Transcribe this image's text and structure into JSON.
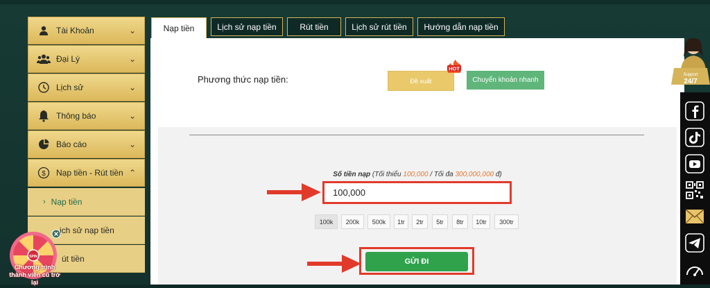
{
  "sidebar": {
    "items": [
      {
        "label": "Tài Khoản",
        "icon": "user-icon"
      },
      {
        "label": "Đại Lý",
        "icon": "group-icon"
      },
      {
        "label": "Lịch sử",
        "icon": "history-icon"
      },
      {
        "label": "Thông báo",
        "icon": "bell-icon"
      },
      {
        "label": "Báo cáo",
        "icon": "pie-chart-icon"
      },
      {
        "label": "Nạp tiền - Rút tiền",
        "icon": "money-circle-icon"
      }
    ],
    "sub_items": [
      {
        "label": "Nạp tiền"
      },
      {
        "label": "ịch sử nạp tiền"
      },
      {
        "label": "út tiền"
      }
    ]
  },
  "tabs": [
    {
      "label": "Nạp tiền"
    },
    {
      "label": "Lịch sử nạp tiền"
    },
    {
      "label": "Rút tiền"
    },
    {
      "label": "Lịch sử rút tiền"
    },
    {
      "label": "Hướng dẫn nạp tiền"
    }
  ],
  "method": {
    "label": "Phương thức nạp tiền:",
    "suggest_label": "Đề xuất",
    "hot_badge": "HOT",
    "fast_label": "Chuyển khoản nhanh"
  },
  "amount": {
    "title": "Số tiền nạp",
    "hint_prefix": "(Tối thiểu ",
    "min": "100,000",
    "hint_mid": " / Tối đa ",
    "max": "300,000,000",
    "hint_suffix": " đ)",
    "value": "100,000"
  },
  "chips": [
    "100k",
    "200k",
    "500k",
    "1tr",
    "2tr",
    "5tr",
    "8tr",
    "10tr",
    "300tr"
  ],
  "submit_label": "GỬI ĐI",
  "support": {
    "line1": "Support",
    "line2": "24/7"
  },
  "spin": {
    "badge": "SPIN",
    "text": "Chương trình thành viên cũ trở lại"
  },
  "colors": {
    "gold": "#e8cf86",
    "dark_green": "#0f2a26",
    "highlight_red": "#e23a2a",
    "submit_green": "#2fa24b",
    "orange": "#e8762c"
  }
}
